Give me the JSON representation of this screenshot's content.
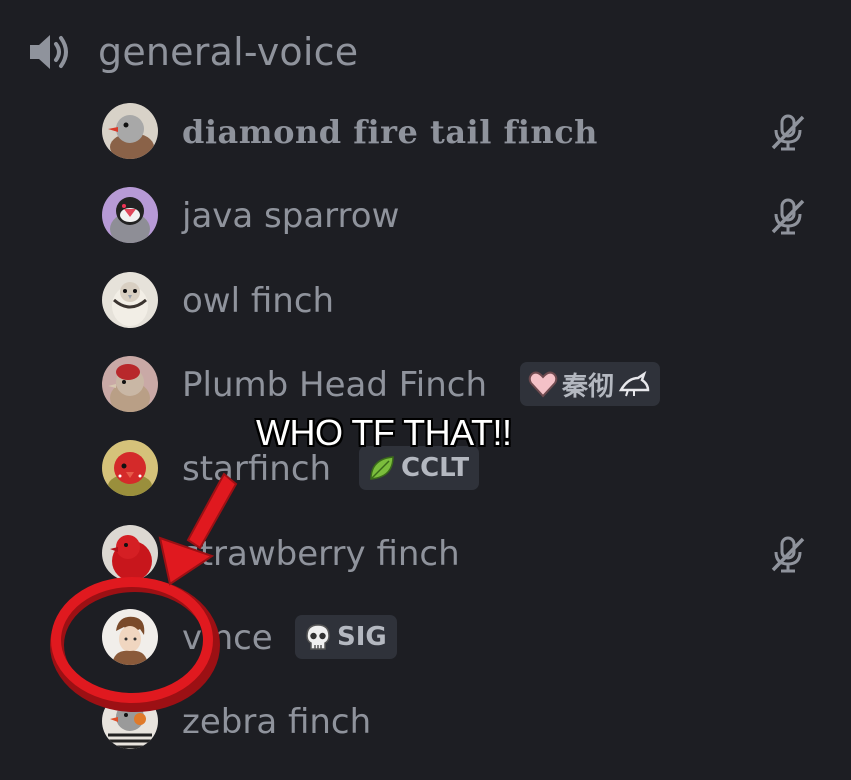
{
  "channel": {
    "name": "general-voice",
    "icon": "speaker-icon"
  },
  "members": [
    {
      "name": "diamond fire tail finch",
      "muted": true,
      "tag": null
    },
    {
      "name": "java sparrow",
      "muted": true,
      "tag": null
    },
    {
      "name": "owl finch",
      "muted": false,
      "tag": null
    },
    {
      "name": "Plumb Head Finch",
      "muted": false,
      "tag": {
        "label": "秦彻",
        "icons": [
          "heart-icon",
          "bird-icon"
        ]
      }
    },
    {
      "name": "starfinch",
      "muted": false,
      "tag": {
        "label": "CCLT",
        "icons": [
          "leaf-icon"
        ]
      }
    },
    {
      "name": "strawberry finch",
      "muted": true,
      "tag": null
    },
    {
      "name": "vince",
      "muted": false,
      "tag": {
        "label": "SIG",
        "icons": [
          "skull-icon"
        ]
      }
    },
    {
      "name": "zebra finch",
      "muted": false,
      "tag": null
    }
  ],
  "annotation": {
    "caption": "WHO TF THAT!!",
    "color": "#e0191f"
  },
  "colors": {
    "background": "#1d1e23",
    "text": "#8f939c",
    "tag_background": "#2f323a"
  }
}
